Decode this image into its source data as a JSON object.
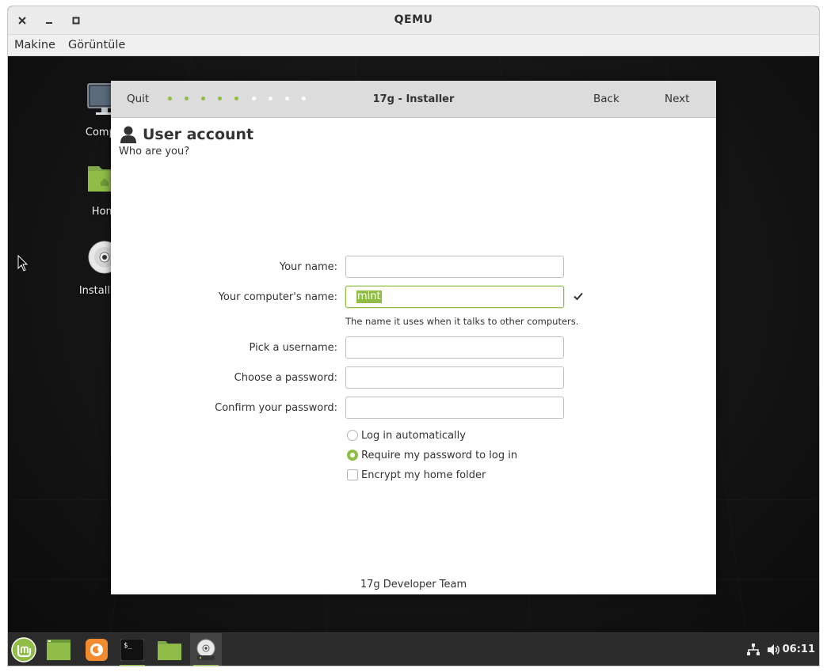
{
  "window": {
    "title": "QEMU"
  },
  "menu": {
    "items": [
      "Makine",
      "Görüntüle"
    ]
  },
  "desktop": {
    "icons": [
      {
        "label": "Compu",
        "icon": "computer-icon"
      },
      {
        "label": "Hom",
        "icon": "home-folder-icon"
      },
      {
        "label": "Install Lin",
        "icon": "install-disc-icon"
      }
    ]
  },
  "installer": {
    "quit_label": "Quit",
    "title": "17g - Installer",
    "back_label": "Back",
    "next_label": "Next",
    "progress": {
      "completed_steps": 5,
      "total_steps": 9
    },
    "page_title": "User account",
    "page_subtitle": "Who are you?",
    "fields": {
      "name": {
        "label": "Your name:",
        "value": ""
      },
      "computer_name": {
        "label": "Your computer's name:",
        "value": "mint",
        "hint": "The name it uses when it talks to other computers."
      },
      "username": {
        "label": "Pick a username:",
        "value": ""
      },
      "password": {
        "label": "Choose a password:",
        "value": ""
      },
      "confirm_password": {
        "label": "Confirm your password:",
        "value": ""
      }
    },
    "options": {
      "login_auto": {
        "label": "Log in automatically",
        "selected": false
      },
      "require_password": {
        "label": "Require my password to log in",
        "selected": true
      },
      "encrypt_home": {
        "label": "Encrypt my home folder",
        "checked": false
      }
    },
    "footer": "17g Developer Team"
  },
  "taskbar": {
    "apps": [
      "mint-menu-icon",
      "show-desktop-icon",
      "firefox-icon",
      "terminal-icon",
      "files-icon",
      "installer-icon"
    ],
    "clock": "06:11"
  },
  "colors": {
    "accent": "#8fbd47",
    "panel": "#2b2b2b",
    "header": "#dcdcdc"
  }
}
